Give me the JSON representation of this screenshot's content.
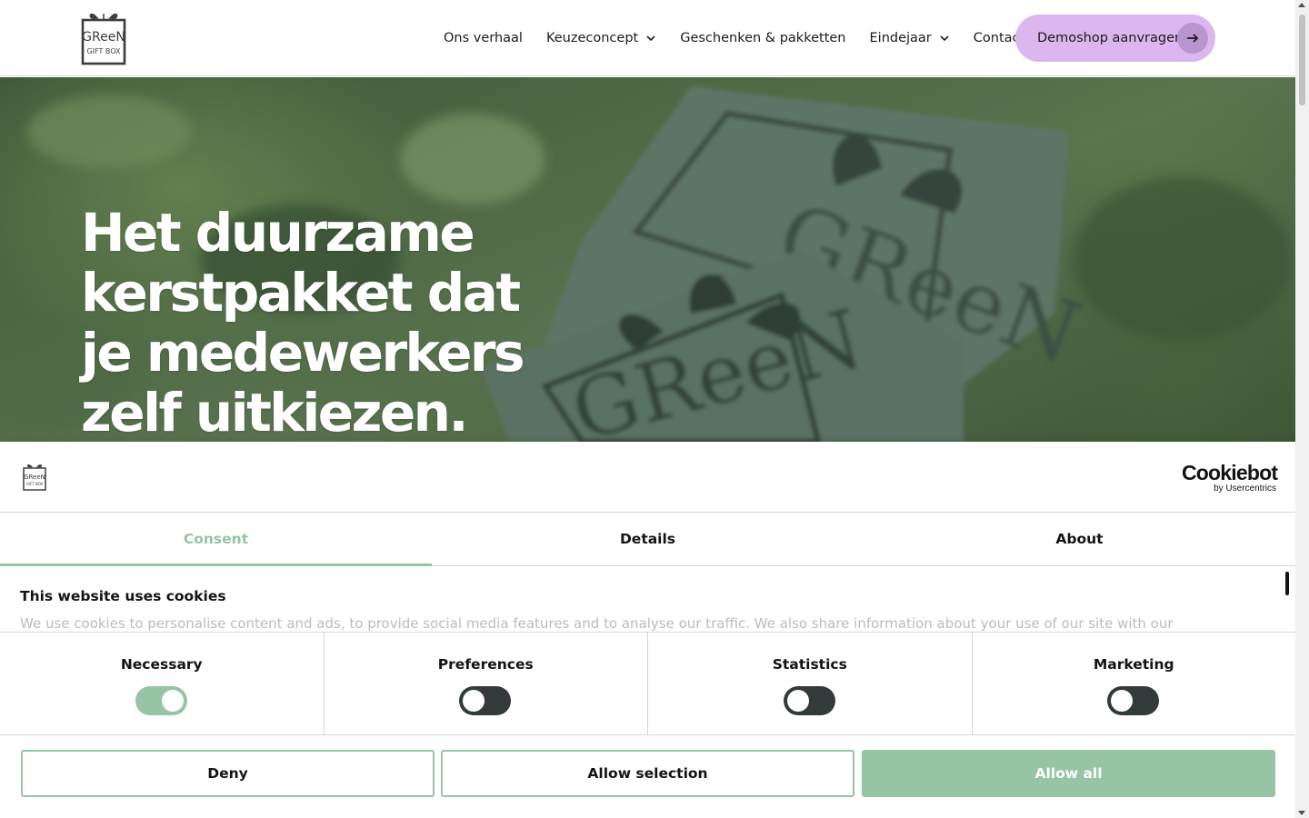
{
  "header": {
    "logo_alt": "Green Gift Box",
    "nav": [
      {
        "label": "Ons verhaal",
        "has_dropdown": false
      },
      {
        "label": "Keuzeconcept",
        "has_dropdown": true
      },
      {
        "label": "Geschenken & pakketten",
        "has_dropdown": false
      },
      {
        "label": "Eindejaar",
        "has_dropdown": true
      },
      {
        "label": "Contact",
        "has_dropdown": false
      }
    ],
    "cta_label": "Demoshop aanvragen",
    "cta_icon": "arrow-right-icon"
  },
  "hero": {
    "title_lines": [
      "Het duurzame",
      "kerstpakket dat",
      "je medewerkers",
      "zelf uitkiezen."
    ]
  },
  "cookie_dialog": {
    "brand": "Cookiebot",
    "brand_sub": "by Usercentrics",
    "tabs": [
      {
        "label": "Consent",
        "active": true
      },
      {
        "label": "Details",
        "active": false
      },
      {
        "label": "About",
        "active": false
      }
    ],
    "heading": "This website uses cookies",
    "body_text": "We use cookies to personalise content and ads, to provide social media features and to analyse our traffic. We also share information about your use of our site with our",
    "categories": [
      {
        "label": "Necessary",
        "enabled": true
      },
      {
        "label": "Preferences",
        "enabled": false
      },
      {
        "label": "Statistics",
        "enabled": false
      },
      {
        "label": "Marketing",
        "enabled": false
      }
    ],
    "buttons": {
      "deny": "Deny",
      "allow_selection": "Allow selection",
      "allow_all": "Allow all"
    }
  },
  "colors": {
    "accent_green": "#97c4a4",
    "cta_purple": "#dcb6ef",
    "toggle_off": "#333b3a"
  }
}
